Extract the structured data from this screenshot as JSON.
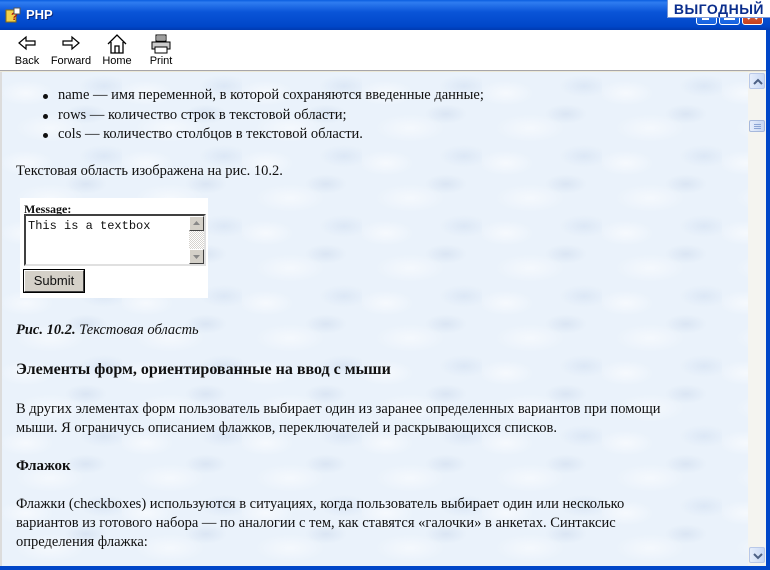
{
  "window": {
    "title": "PHP",
    "promo": "ВЫГОДНЫЙ"
  },
  "toolbar": {
    "back": "Back",
    "forward": "Forward",
    "home": "Home",
    "print": "Print"
  },
  "content": {
    "bullets": [
      "name — имя переменной, в которой сохраняются введенные данные;",
      "rows — количество строк в текстовой области;",
      "cols — количество столбцов в текстовой области."
    ],
    "intro": "Текстовая область изображена на рис. 10.2.",
    "demo": {
      "label": "Message:",
      "textarea_value": "This is a textbox",
      "submit": "Submit"
    },
    "caption_bold": "Рис. 10.2.",
    "caption_text": " Текстовая область",
    "heading": "Элементы форм, ориентированные на ввод с мыши",
    "para1_line1": "В других элементах форм пользователь выбирает один из заранее определенных вариантов при помощи",
    "para1_line2": "мыши. Я ограничусь описанием флажков, переключателей и раскрывающихся списков.",
    "subheading": "Флажок",
    "para2_line1": "Флажки (checkboxes) используются в ситуациях, когда пользователь выбирает один или несколько",
    "para2_line2": "вариантов из готового набора — по аналогии с тем, как ставятся «галочки» в анкетах. Синтаксис",
    "para2_line3": "определения флажка:"
  },
  "colors": {
    "titlebar": "#0046c8",
    "page_bg": "#eaf2fb"
  }
}
